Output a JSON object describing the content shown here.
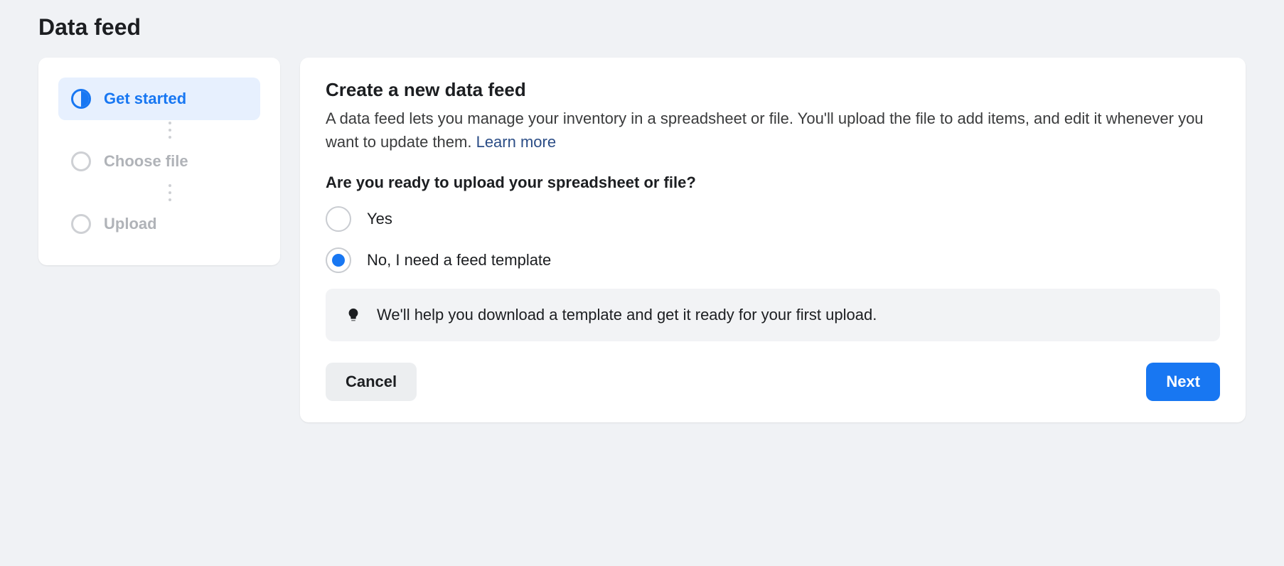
{
  "page": {
    "title": "Data feed"
  },
  "sidebar": {
    "steps": [
      {
        "label": "Get started",
        "active": true
      },
      {
        "label": "Choose file",
        "active": false
      },
      {
        "label": "Upload",
        "active": false
      }
    ]
  },
  "main": {
    "title": "Create a new data feed",
    "description": "A data feed lets you manage your inventory in a spreadsheet or file. You'll upload the file to add items, and edit it whenever you want to update them. ",
    "learn_more": "Learn more",
    "question": "Are you ready to upload your spreadsheet or file?",
    "options": {
      "yes": "Yes",
      "no": "No, I need a feed template"
    },
    "info": "We'll help you download a template and get it ready for your first upload.",
    "buttons": {
      "cancel": "Cancel",
      "next": "Next"
    }
  }
}
